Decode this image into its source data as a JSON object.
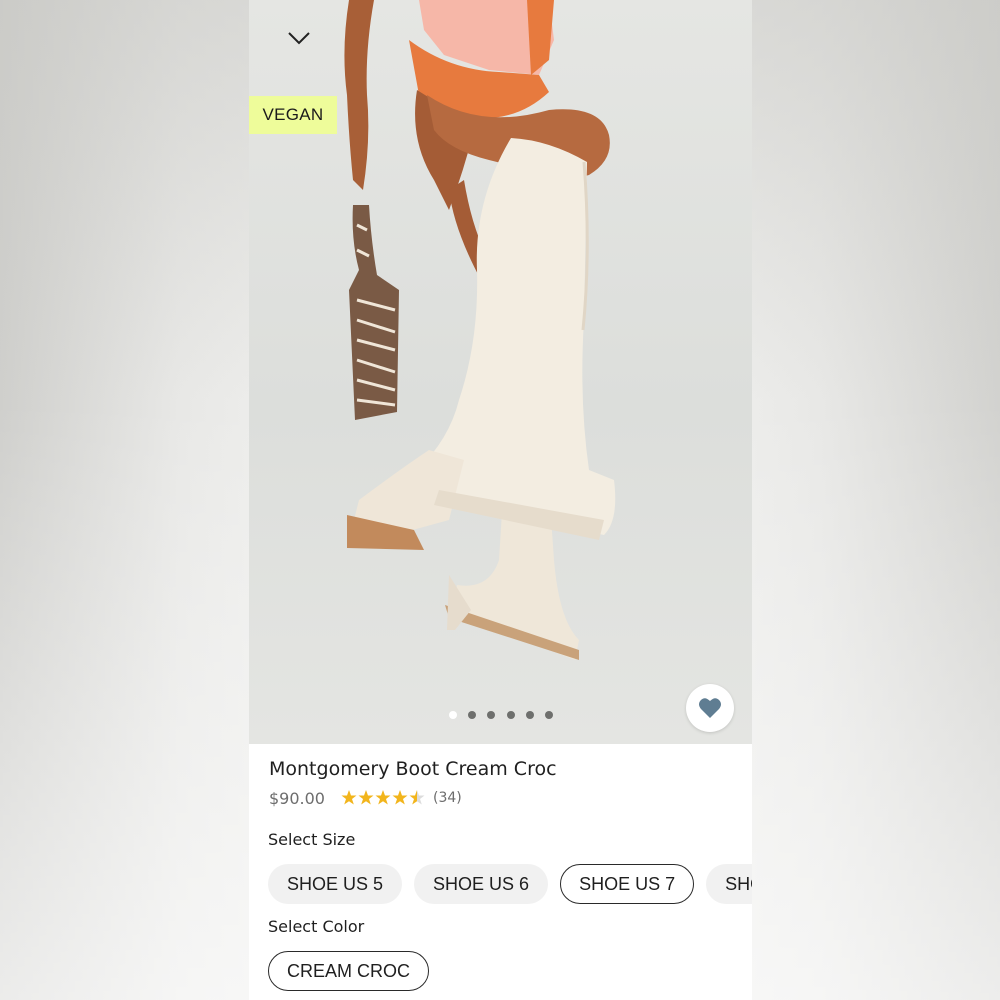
{
  "badges": {
    "vegan": "VEGAN"
  },
  "gallery": {
    "image_count": 6,
    "active_index": 0
  },
  "product": {
    "title": "Montgomery Boot Cream Croc",
    "price": "$90.00",
    "rating": 4.5,
    "review_count": "(34)"
  },
  "size_section": {
    "label": "Select Size",
    "options": [
      "SHOE US 5",
      "SHOE US 6",
      "SHOE US 7",
      "SHOE"
    ],
    "selected": "SHOE US 7"
  },
  "color_section": {
    "label": "Select Color",
    "options": [
      "CREAM CROC"
    ],
    "selected": "CREAM CROC"
  },
  "colors": {
    "vegan_badge": "#eefc9a",
    "star": "#f2b51c",
    "heart": "#5f7d92"
  },
  "icons": {
    "close": "chevron-down-icon",
    "favorite": "heart-icon",
    "rating": "star-icon"
  }
}
